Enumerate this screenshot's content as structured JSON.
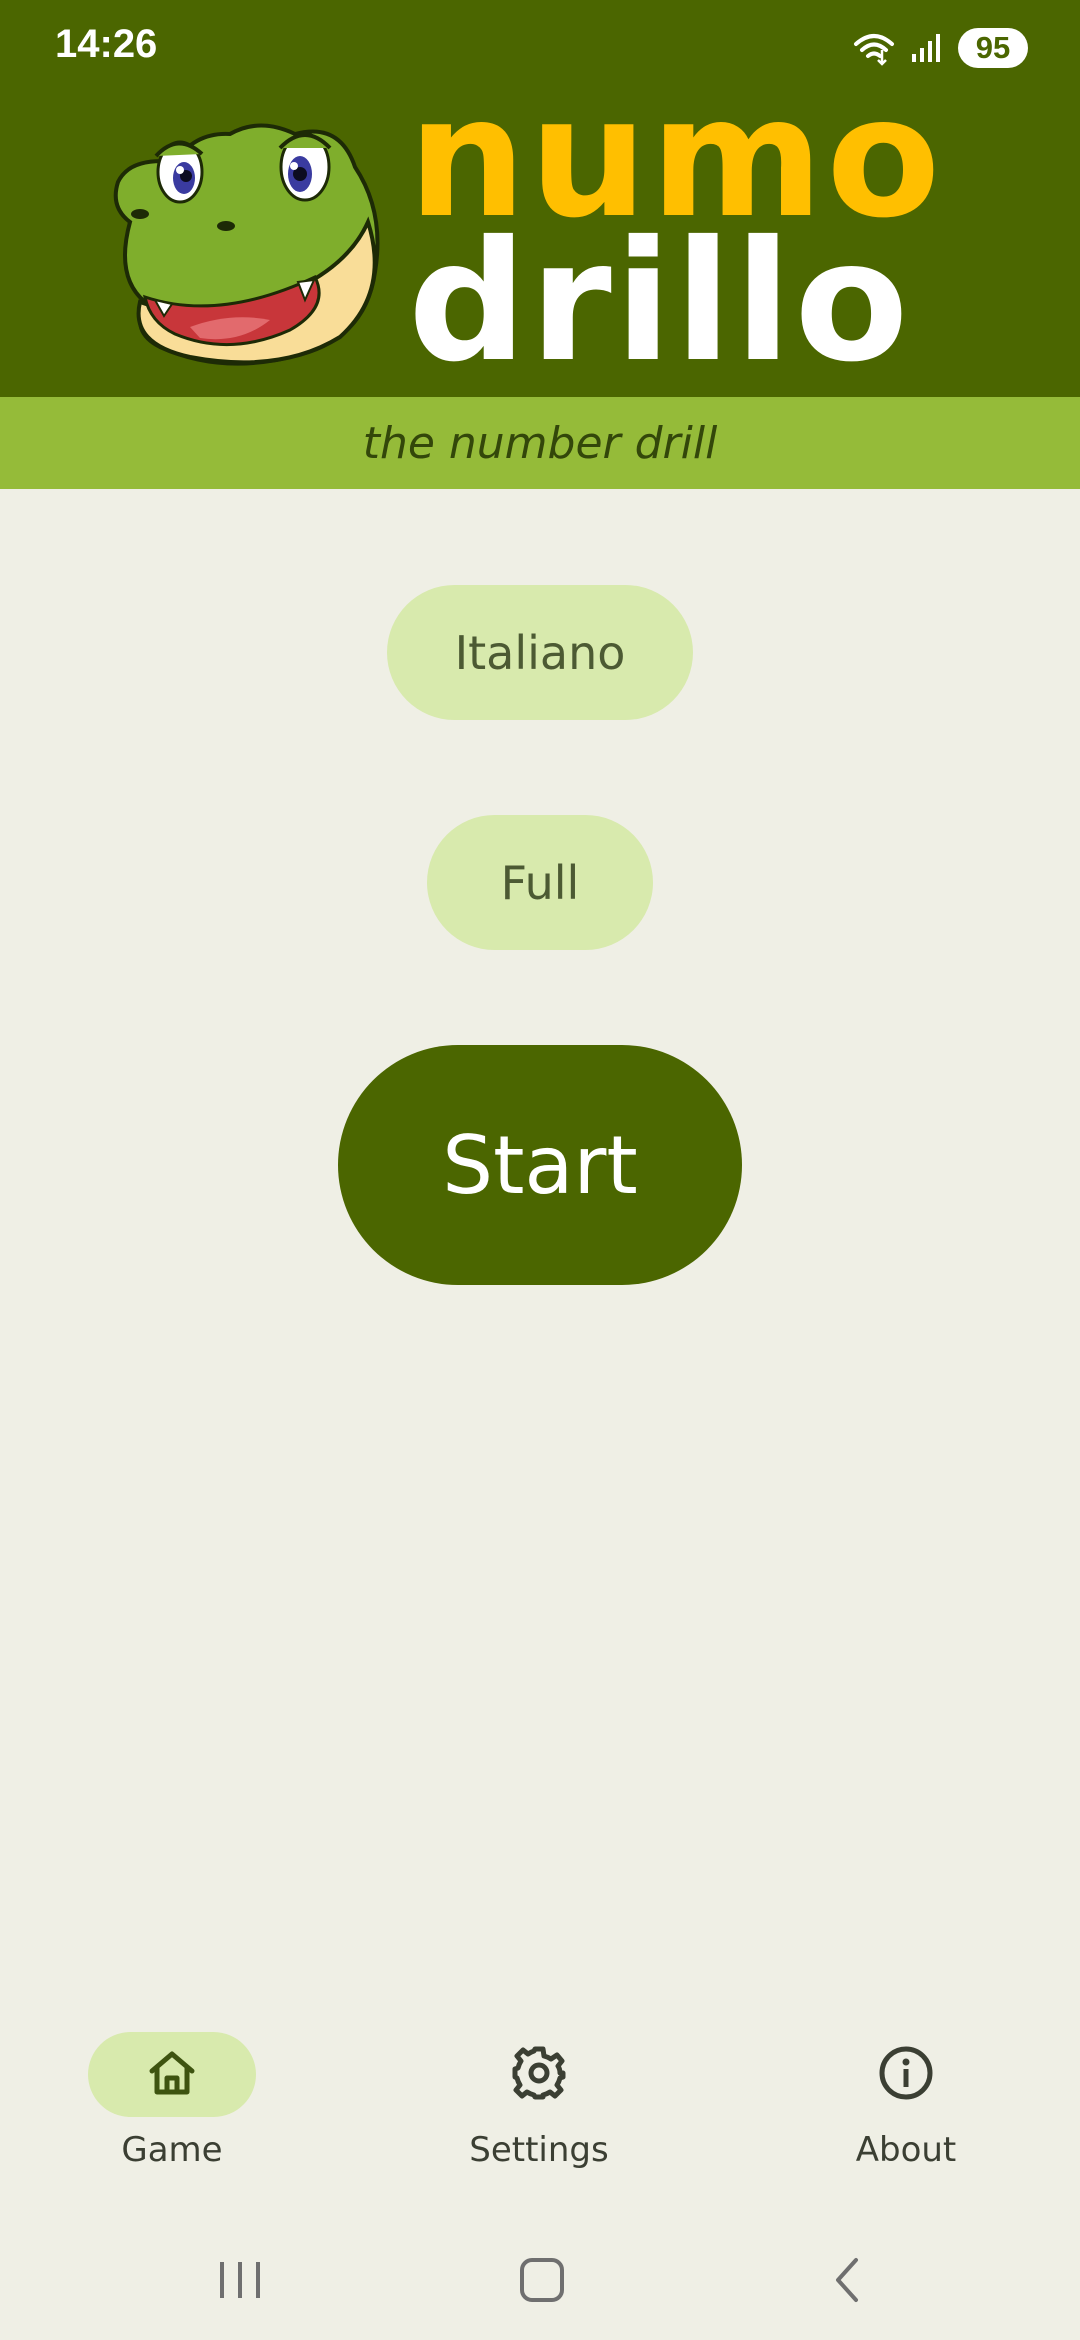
{
  "status_bar": {
    "time": "14:26",
    "battery": "95",
    "icons": [
      "wifi-icon",
      "signal-icon",
      "battery-icon"
    ]
  },
  "header": {
    "logo_top": "numo",
    "logo_bottom": "drillo",
    "subtitle": "the number drill",
    "mascot": "crocodile-mascot",
    "colors": {
      "header_bg": "#4b6600",
      "logo_top": "#ffbf00",
      "logo_bottom": "#ffffff",
      "subtitle_bg": "#95bb39"
    }
  },
  "main": {
    "language_button": "Italiano",
    "mode_button": "Full",
    "start_button": "Start"
  },
  "bottom_nav": {
    "items": [
      {
        "label": "Game",
        "icon": "home-icon",
        "active": true
      },
      {
        "label": "Settings",
        "icon": "gear-icon",
        "active": false
      },
      {
        "label": "About",
        "icon": "info-icon",
        "active": false
      }
    ]
  },
  "system_nav": {
    "buttons": [
      "recent-apps-icon",
      "home-button-icon",
      "back-icon"
    ]
  }
}
